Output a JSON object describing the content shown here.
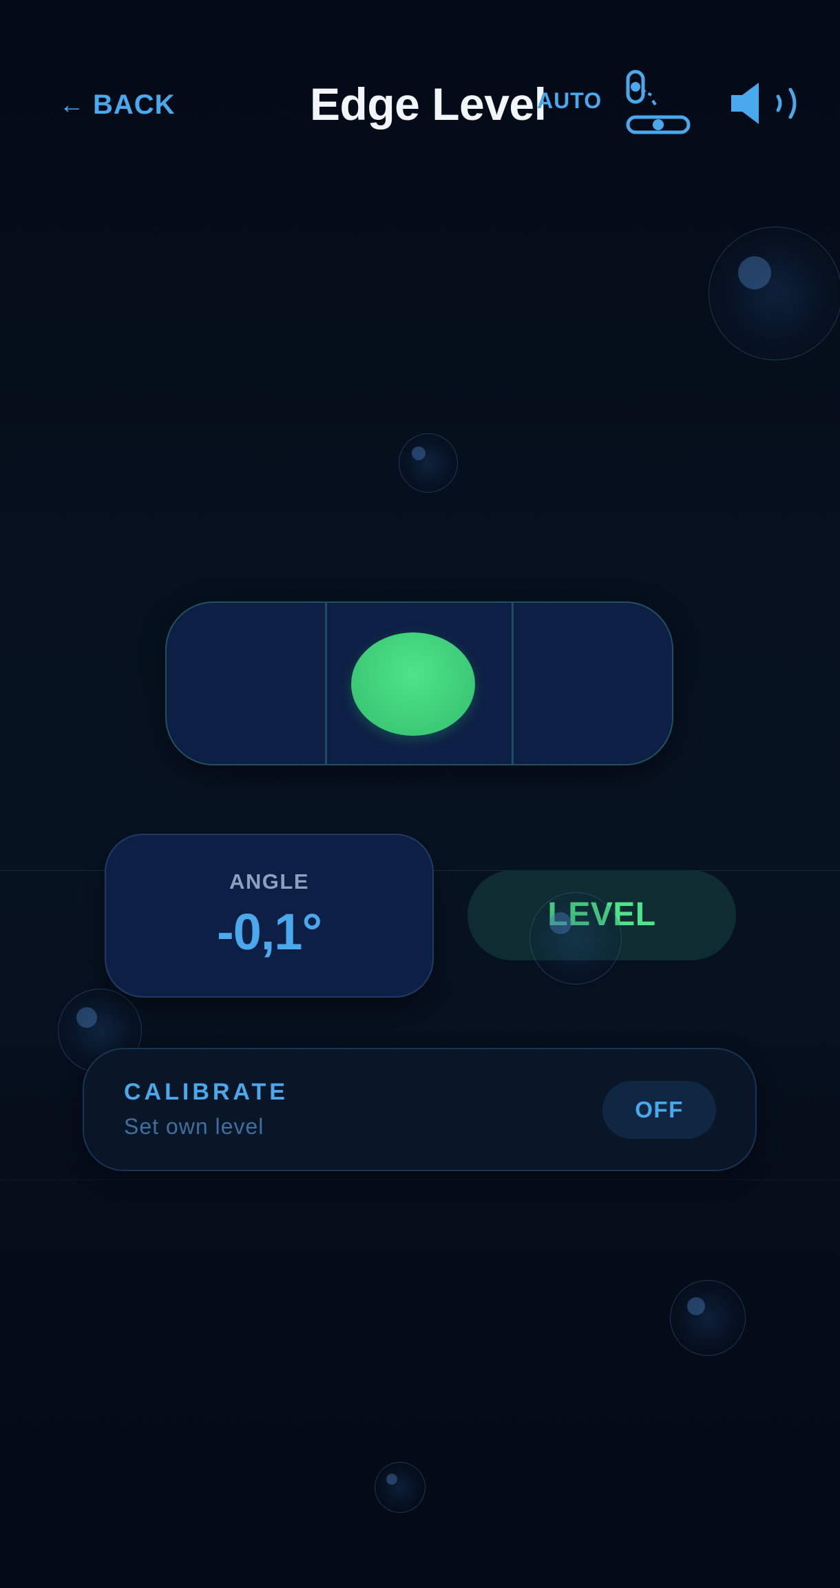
{
  "header": {
    "back_label": "BACK",
    "back_arrow": "←",
    "title": "Edge Level",
    "auto_label": "AUTO",
    "auto_icon": "auto-mode-icon",
    "sound_icon": "speaker-icon"
  },
  "level": {
    "status": "LEVEL",
    "bubble_color": "#40cf7a"
  },
  "angle": {
    "label": "ANGLE",
    "value": "-0,1°"
  },
  "calibrate": {
    "title": "CALIBRATE",
    "subtitle": "Set own level",
    "toggle_state": "OFF"
  },
  "colors": {
    "accent": "#4aa8ec",
    "level_green": "#4ee489",
    "background": "#06101e",
    "card": "#0e1f45"
  }
}
